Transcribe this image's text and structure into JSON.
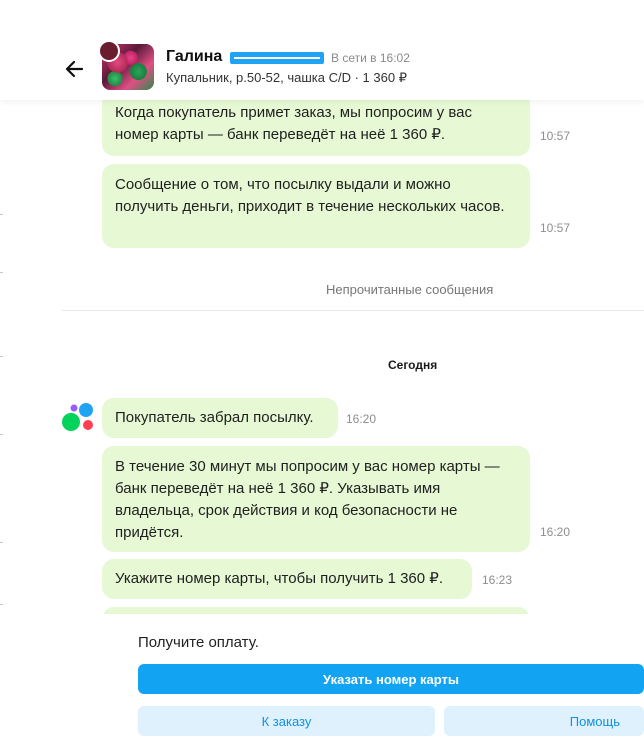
{
  "header": {
    "name": "Галина",
    "status": "В сети в 16:02",
    "subtitle": "Купальник, р.50-52, чашка C/D · 1 360 ₽"
  },
  "messages": [
    {
      "text": "Когда покупатель примет заказ, мы попросим у вас номер карты — банк переведёт на неё 1 360 ₽.",
      "time": "10:57"
    },
    {
      "text": "Сообщение о том, что посылку выдали и можно получить деньги, приходит в течение нескольких часов.",
      "time": "10:57"
    },
    {
      "text": "Покупатель забрал посылку.",
      "time": "16:20"
    },
    {
      "text": "В течение 30 минут мы попросим у вас номер карты — банк переведёт на неё 1 360 ₽. Указывать имя владельца, срок действия и код безопасности не придётся.",
      "time": "16:20"
    },
    {
      "text": "Укажите номер карты, чтобы получить 1 360 ₽.",
      "time": "16:23"
    }
  ],
  "unread_divider": "Непрочитанные сообщения",
  "date_divider": "Сегодня",
  "footer": {
    "prompt": "Получите оплату.",
    "primary_button": "Указать номер карты",
    "order_button": "К заказу",
    "help_button": "Помощь"
  },
  "colors": {
    "bubble": "#e6f9d4",
    "accent": "#12a4f3",
    "secondary_button_bg": "#dff1fd",
    "secondary_button_text": "#1191e0"
  },
  "icons": [
    "back-arrow-icon",
    "service-logo-icon"
  ]
}
